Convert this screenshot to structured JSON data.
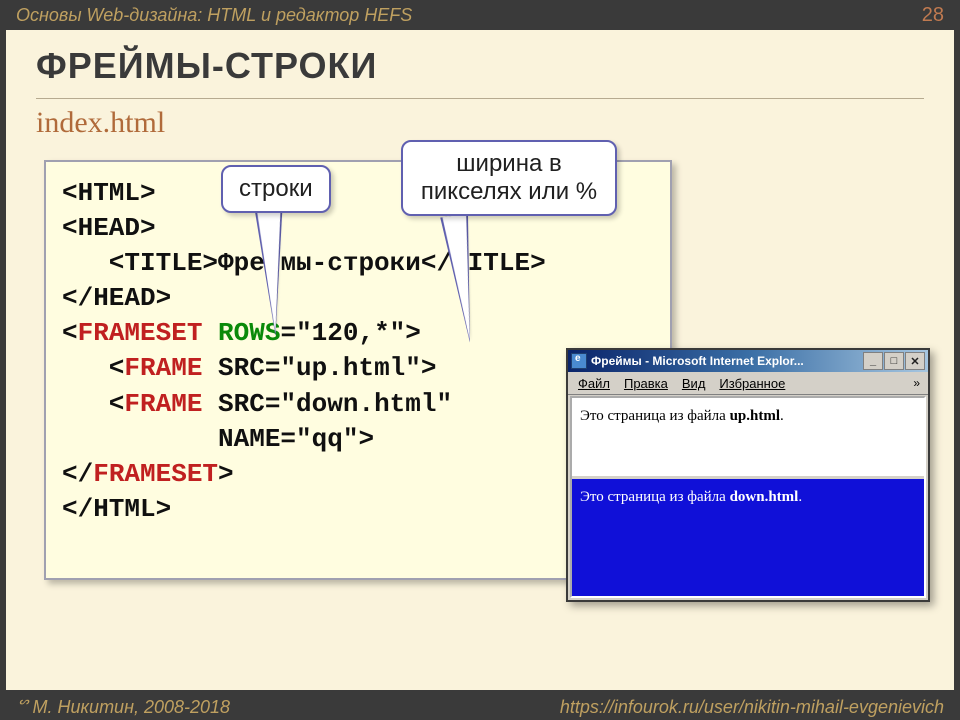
{
  "header": {
    "course": "Основы Web-дизайна: HTML и редактор HEFS",
    "page": "28"
  },
  "title": "ФРЕЙМЫ-СТРОКИ",
  "subtitle": "index.html",
  "callouts": {
    "rows": "строки",
    "width": "ширина в пикселях или %"
  },
  "code": {
    "l1": "<HTML>",
    "l2": "<HEAD>",
    "l3a": "   <TITLE>",
    "l3b": "Фреймы-строки",
    "l3c": "</TITLE>",
    "l4": "</HEAD>",
    "l5a": "<",
    "l5b": "FRAMESET",
    "l5c": " ",
    "l5d": "ROWS",
    "l5e": "=\"120,*\">",
    "l6a": "   <",
    "l6b": "FRAME",
    "l6c": " SRC=\"up.html\">",
    "l7a": "   <",
    "l7b": "FRAME",
    "l7c": " SRC=\"down.html\"",
    "l8": "          NAME=\"qq\">",
    "l9a": "</",
    "l9b": "FRAMESET",
    "l9c": ">",
    "l10": "</HTML>"
  },
  "browser": {
    "title": "Фреймы - Microsoft Internet Explor...",
    "menu": {
      "file": "Файл",
      "edit": "Правка",
      "view": "Вид",
      "fav": "Избранное",
      "more": "»"
    },
    "up_prefix": "Это страница из файла ",
    "up_file": "up.html",
    "dot": ".",
    "down_prefix": "Это страница из файла ",
    "down_file": "down.html"
  },
  "footer": {
    "author": "М. Никитин, 2008-2018",
    "url": "https://infourok.ru/user/nikitin-mihail-evgenievich"
  }
}
